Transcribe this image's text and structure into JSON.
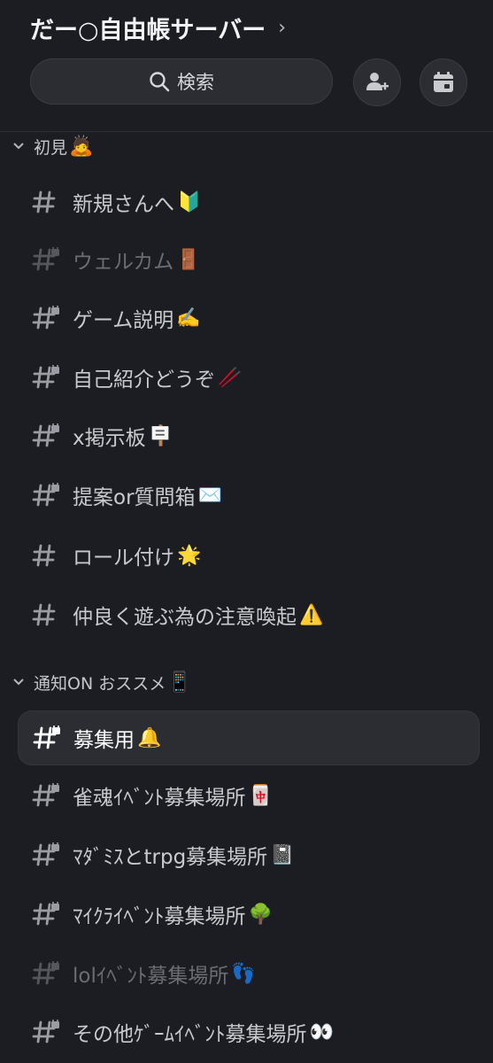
{
  "header": {
    "server_name": "だー○自由帳サーバー",
    "chevron": "›",
    "search_label": "検索",
    "search_icon": "search-icon",
    "add_member_icon": "add-member-icon",
    "events_icon": "calendar-icon"
  },
  "categories": [
    {
      "name": "初見",
      "emoji": "🙇",
      "channels": [
        {
          "name": "新規さんへ",
          "emoji": "🔰",
          "locked": false,
          "muted": false
        },
        {
          "name": "ウェルカム",
          "emoji": "🚪",
          "locked": true,
          "muted": true
        },
        {
          "name": "ゲーム説明",
          "emoji": "✍️",
          "locked": true,
          "muted": false
        },
        {
          "name": "自己紹介どうぞ",
          "emoji": "🥢",
          "locked": true,
          "muted": false
        },
        {
          "name": "x掲示板",
          "emoji": "🪧",
          "locked": true,
          "muted": false
        },
        {
          "name": "提案or質問箱",
          "emoji": "✉️",
          "locked": true,
          "muted": false
        },
        {
          "name": "ロール付け",
          "emoji": "🌟",
          "locked": false,
          "muted": false
        },
        {
          "name": "仲良く遊ぶ為の注意喚起",
          "emoji": "⚠️",
          "locked": false,
          "muted": false
        }
      ]
    },
    {
      "name": "通知ON おススメ",
      "emoji": "📱",
      "channels": [
        {
          "name": "募集用",
          "emoji": "🔔",
          "locked": true,
          "muted": false,
          "active": true
        },
        {
          "name": "雀魂ｲﾍﾞﾝﾄ募集場所",
          "emoji": "🀄",
          "locked": true,
          "muted": false
        },
        {
          "name": "ﾏﾀﾞﾐｽとtrpg募集場所",
          "emoji": "📓",
          "locked": true,
          "muted": false
        },
        {
          "name": "ﾏｲｸﾗｲﾍﾞﾝﾄ募集場所",
          "emoji": "🌳",
          "locked": true,
          "muted": false
        },
        {
          "name": "lolｲﾍﾞﾝﾄ募集場所",
          "emoji": "👣",
          "locked": true,
          "muted": true
        },
        {
          "name": "その他ｹﾞｰﾑｲﾍﾞﾝﾄ募集場所",
          "emoji": "👀",
          "locked": true,
          "muted": false
        }
      ]
    }
  ],
  "colors": {
    "background": "#1c1d22",
    "surface": "#2b2d33",
    "text": "#c9cace",
    "muted_text": "#6b6d74",
    "active_text": "#ffffff"
  }
}
